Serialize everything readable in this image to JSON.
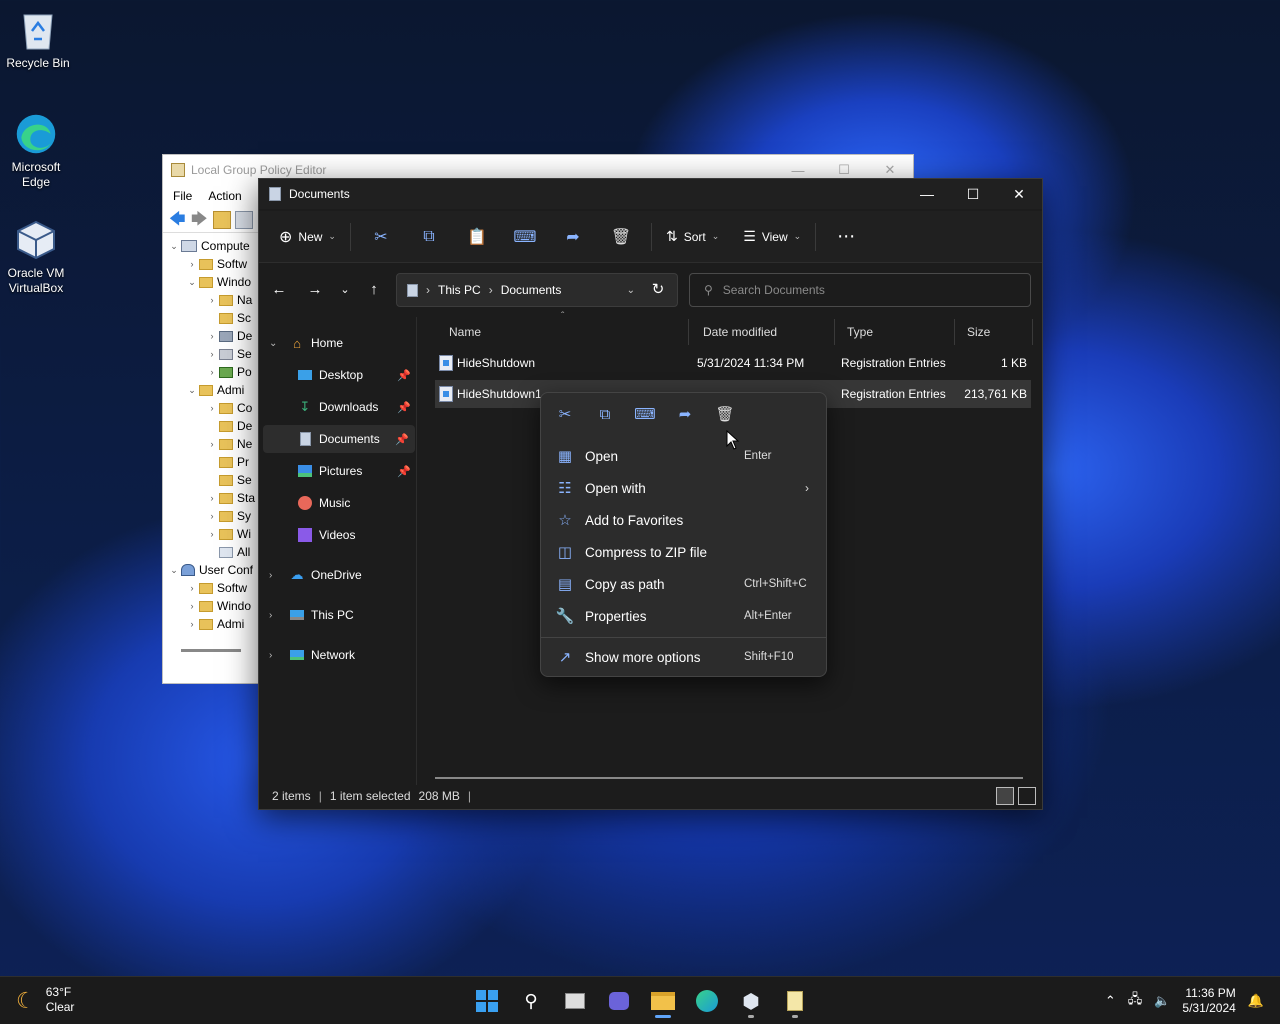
{
  "desktop": {
    "icons": [
      {
        "label": "Recycle Bin"
      },
      {
        "label": "Microsoft Edge"
      },
      {
        "label": "Oracle VM VirtualBox"
      }
    ]
  },
  "gpedit": {
    "title": "Local Group Policy Editor",
    "menu": [
      "File",
      "Action"
    ],
    "tree": [
      "Compute",
      "Softw",
      "Windo",
      "Na",
      "Sc",
      "De",
      "Se",
      "Po",
      "Admi",
      "Co",
      "De",
      "Ne",
      "Pr",
      "Se",
      "Sta",
      "Sy",
      "Wi",
      "All",
      "User Conf",
      "Softw",
      "Windo",
      "Admi"
    ]
  },
  "explorer": {
    "title": "Documents",
    "toolbar": {
      "new_label": "New",
      "sort_label": "Sort",
      "view_label": "View"
    },
    "address": {
      "segment1": "This PC",
      "segment2": "Documents"
    },
    "search": {
      "placeholder": "Search Documents"
    },
    "nav": [
      {
        "label": "Home"
      },
      {
        "label": "Desktop"
      },
      {
        "label": "Downloads"
      },
      {
        "label": "Documents"
      },
      {
        "label": "Pictures"
      },
      {
        "label": "Music"
      },
      {
        "label": "Videos"
      },
      {
        "label": "OneDrive"
      },
      {
        "label": "This PC"
      },
      {
        "label": "Network"
      }
    ],
    "columns": {
      "name": "Name",
      "date": "Date modified",
      "type": "Type",
      "size": "Size"
    },
    "files": [
      {
        "name": "HideShutdown",
        "date": "5/31/2024 11:34 PM",
        "type": "Registration Entries",
        "size": "1 KB"
      },
      {
        "name": "HideShutdown1",
        "date": "",
        "type": "Registration Entries",
        "size": "213,761 KB"
      }
    ],
    "status": {
      "items": "2 items",
      "selected": "1 item selected",
      "size": "208 MB"
    }
  },
  "context_menu": {
    "items": [
      {
        "label": "Open",
        "shortcut": "Enter"
      },
      {
        "label": "Open with",
        "shortcut": ""
      },
      {
        "label": "Add to Favorites",
        "shortcut": ""
      },
      {
        "label": "Compress to ZIP file",
        "shortcut": ""
      },
      {
        "label": "Copy as path",
        "shortcut": "Ctrl+Shift+C"
      },
      {
        "label": "Properties",
        "shortcut": "Alt+Enter"
      },
      {
        "label": "Show more options",
        "shortcut": "Shift+F10"
      }
    ]
  },
  "taskbar": {
    "weather": {
      "temp": "63°F",
      "condition": "Clear"
    },
    "clock": {
      "time": "11:36 PM",
      "date": "5/31/2024"
    }
  }
}
